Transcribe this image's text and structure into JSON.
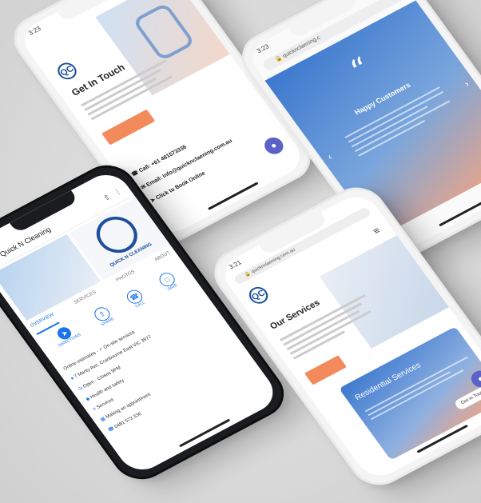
{
  "contact_phone": {
    "status_time": "3:23",
    "heading": "Get In Touch",
    "cta": "",
    "lines": [
      "Call: +61 481573336",
      "Email: info@quicknclaening.com.au",
      "Click to Book Online"
    ]
  },
  "testimonial_phone": {
    "status_time": "3:23",
    "url": "quicknclaening.c",
    "quote_mark": "“",
    "heading": "Happy Customers"
  },
  "profile_phone": {
    "status_time": "",
    "business_name": "Quick N Cleaning",
    "logo_text": "QUICK N CLEANING",
    "tabs": [
      "OVERVIEW",
      "SERVICES",
      "PHOTOS",
      "ABOUT"
    ],
    "actions": [
      "DIRECTIONS",
      "SHARE",
      "CALL",
      "SAVE"
    ],
    "info": [
      "Online estimates · ✓ On-site services",
      "7 Manly Ave, Cranbourne East VIC 3977",
      "Open · Closes 9PM",
      "Health and safety",
      "Services",
      "Making an appointment",
      "0481 573 336"
    ]
  },
  "services_phone": {
    "status_time": "3:21",
    "url": "quicknclaening.com.au",
    "heading": "Our Services",
    "cta": "",
    "card_title": "Residential Services",
    "card_cta": "Get in Touch"
  },
  "colors": {
    "brand_blue": "#1f4f9b",
    "accent_orange": "#f28a5c",
    "chat_purple": "#5a62c8",
    "gradient_blue": "#3c78cf",
    "gradient_peach": "#f5a47f"
  }
}
